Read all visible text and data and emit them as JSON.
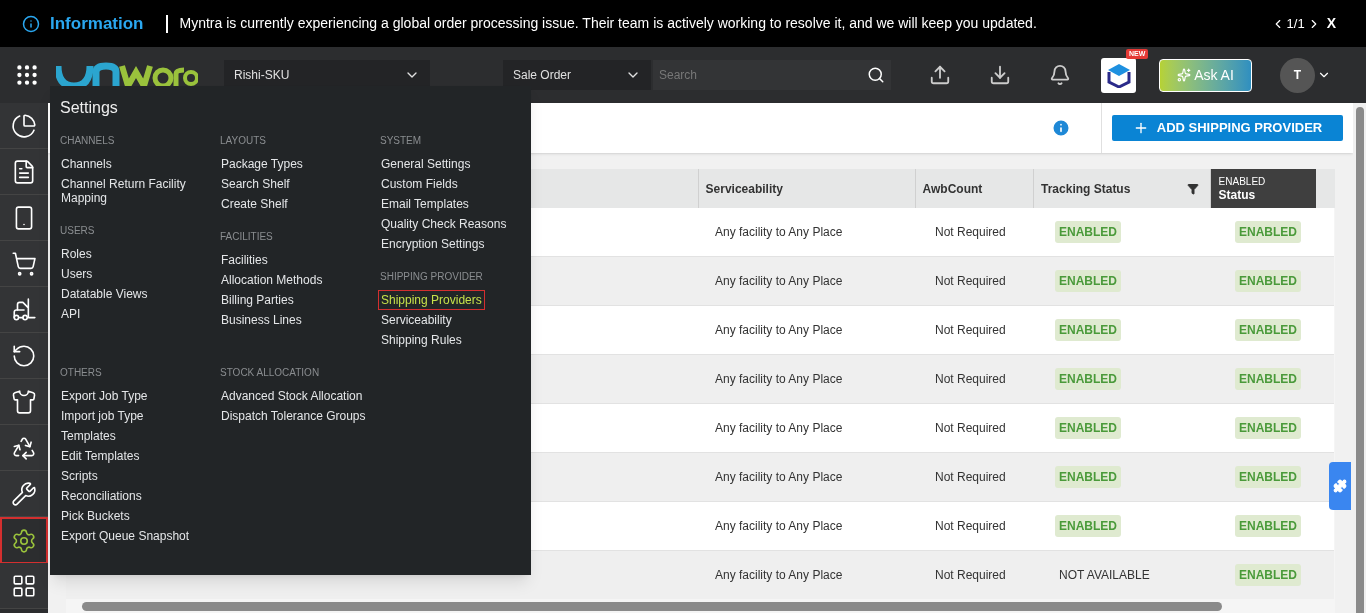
{
  "banner": {
    "title": "Information",
    "message": "Myntra is currently experiencing a global order processing issue. Their team is actively working to resolve it, and we will keep you updated.",
    "pager": "1/1",
    "close": "X"
  },
  "header": {
    "facility": "Rishi-SKU",
    "search_type": "Sale Order",
    "search_placeholder": "Search",
    "new_badge": "NEW",
    "ask_ai": "Ask AI",
    "avatar": "T"
  },
  "sidebar": {
    "items": [
      {
        "selected": false
      },
      {
        "selected": false
      },
      {
        "selected": false
      },
      {
        "selected": false
      },
      {
        "selected": false
      },
      {
        "selected": false
      },
      {
        "selected": false
      },
      {
        "selected": false
      },
      {
        "selected": false
      },
      {
        "selected": true
      },
      {
        "selected": false
      }
    ]
  },
  "toolbar": {
    "add_button": "ADD SHIPPING PROVIDER"
  },
  "table": {
    "columns": [
      {
        "label": "Serviceability"
      },
      {
        "label": "AwbCount"
      },
      {
        "label": "Tracking Status",
        "filter": true
      },
      {
        "label": "Status",
        "filter_value": "ENABLED"
      }
    ],
    "rows": [
      {
        "serviceability": "Any facility to Any Place",
        "awb": "Not Required",
        "tracking": {
          "text": "ENABLED",
          "kind": "badge"
        },
        "status": "ENABLED"
      },
      {
        "serviceability": "Any facility to Any Place",
        "awb": "Not Required",
        "tracking": {
          "text": "ENABLED",
          "kind": "badge"
        },
        "status": "ENABLED"
      },
      {
        "serviceability": "Any facility to Any Place",
        "awb": "Not Required",
        "tracking": {
          "text": "ENABLED",
          "kind": "badge"
        },
        "status": "ENABLED"
      },
      {
        "serviceability": "Any facility to Any Place",
        "awb": "Not Required",
        "tracking": {
          "text": "ENABLED",
          "kind": "badge"
        },
        "status": "ENABLED"
      },
      {
        "serviceability": "Any facility to Any Place",
        "awb": "Not Required",
        "tracking": {
          "text": "ENABLED",
          "kind": "badge"
        },
        "status": "ENABLED"
      },
      {
        "serviceability": "Any facility to Any Place",
        "awb": "Not Required",
        "tracking": {
          "text": "ENABLED",
          "kind": "badge"
        },
        "status": "ENABLED"
      },
      {
        "serviceability": "Any facility to Any Place",
        "awb": "Not Required",
        "tracking": {
          "text": "ENABLED",
          "kind": "badge"
        },
        "status": "ENABLED"
      },
      {
        "serviceability": "Any facility to Any Place",
        "awb": "Not Required",
        "tracking": {
          "text": "NOT AVAILABLE",
          "kind": "plain"
        },
        "status": "ENABLED"
      }
    ]
  },
  "settings_menu": {
    "title": "Settings",
    "columns": [
      [
        {
          "heading": "CHANNELS",
          "items": [
            {
              "label": "Channels",
              "selected": false
            },
            {
              "label": "Channel Return Facility Mapping",
              "selected": false
            }
          ]
        },
        {
          "heading": "USERS",
          "items": [
            {
              "label": "Roles",
              "selected": false
            },
            {
              "label": "Users",
              "selected": false
            },
            {
              "label": "Datatable Views",
              "selected": false
            },
            {
              "label": "API",
              "selected": false
            }
          ]
        }
      ],
      [
        {
          "heading": "LAYOUTS",
          "items": [
            {
              "label": "Package Types",
              "selected": false
            },
            {
              "label": "Search Shelf",
              "selected": false
            },
            {
              "label": "Create Shelf",
              "selected": false
            }
          ]
        },
        {
          "heading": "FACILITIES",
          "items": [
            {
              "label": "Facilities",
              "selected": false
            },
            {
              "label": "Allocation Methods",
              "selected": false
            },
            {
              "label": "Billing Parties",
              "selected": false
            },
            {
              "label": "Business Lines",
              "selected": false
            }
          ]
        }
      ],
      [
        {
          "heading": "SYSTEM",
          "items": [
            {
              "label": "General Settings",
              "selected": false
            },
            {
              "label": "Custom Fields",
              "selected": false
            },
            {
              "label": "Email Templates",
              "selected": false
            },
            {
              "label": "Quality Check Reasons",
              "selected": false
            },
            {
              "label": "Encryption Settings",
              "selected": false
            }
          ]
        },
        {
          "heading": "SHIPPING PROVIDER",
          "items": [
            {
              "label": "Shipping Providers",
              "selected": true
            },
            {
              "label": "Serviceability",
              "selected": false
            },
            {
              "label": "Shipping Rules",
              "selected": false
            }
          ]
        }
      ]
    ],
    "bottom_columns": [
      [
        {
          "heading": "OTHERS",
          "items": [
            {
              "label": "Export Job Type",
              "selected": false
            },
            {
              "label": "Import job Type",
              "selected": false
            },
            {
              "label": "Templates",
              "selected": false
            },
            {
              "label": "Edit Templates",
              "selected": false
            },
            {
              "label": "Scripts",
              "selected": false
            },
            {
              "label": "Reconciliations",
              "selected": false
            },
            {
              "label": "Pick Buckets",
              "selected": false
            },
            {
              "label": "Export Queue Snapshot",
              "selected": false
            }
          ]
        }
      ],
      [
        {
          "heading": "STOCK ALLOCATION",
          "items": [
            {
              "label": "Advanced Stock Allocation",
              "selected": false
            },
            {
              "label": "Dispatch Tolerance Groups",
              "selected": false
            }
          ]
        }
      ]
    ]
  }
}
